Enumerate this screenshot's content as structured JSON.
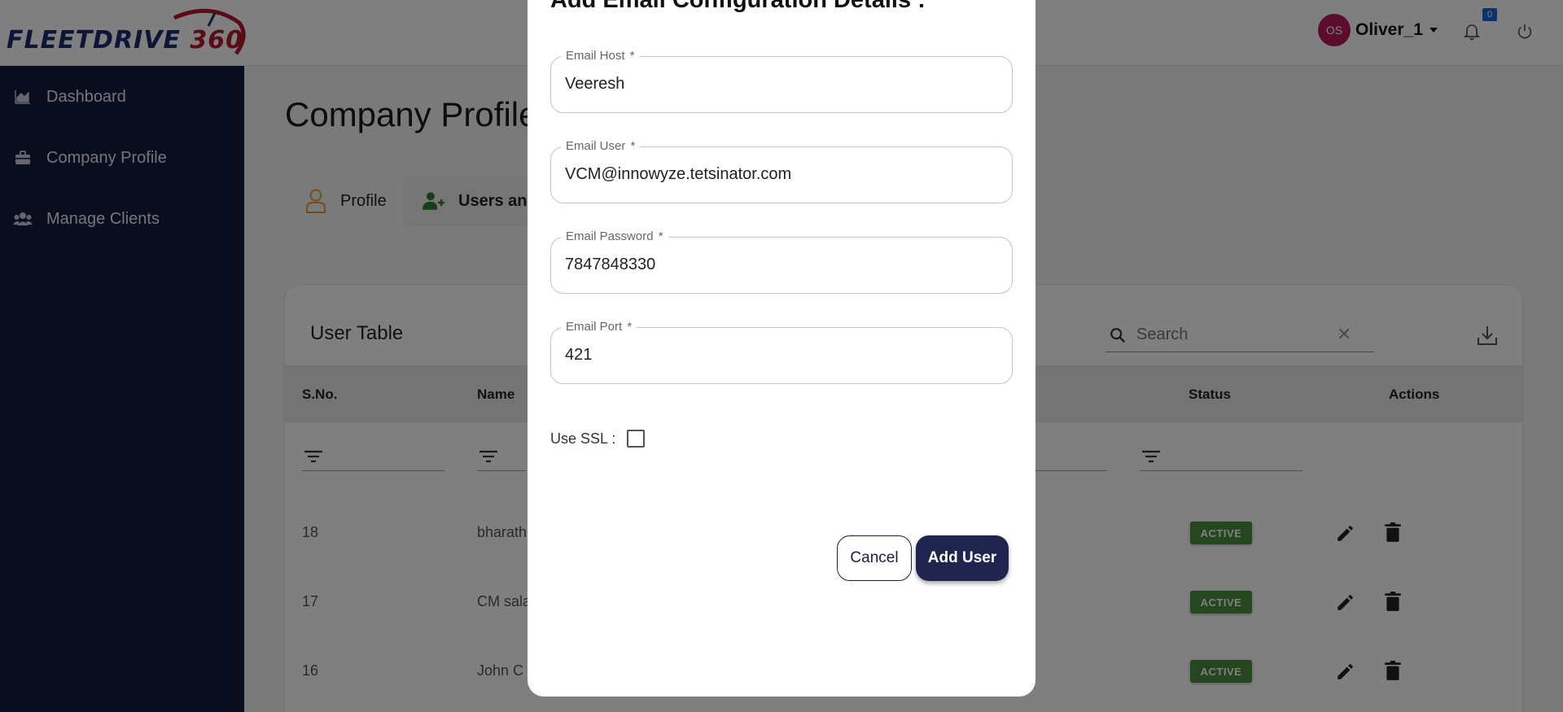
{
  "brand": {
    "logo_text": "FLEETDRIVE",
    "logo_number": "360",
    "primary_color": "#141a3d",
    "accent_color": "#b3182b"
  },
  "header": {
    "user_initials": "OS",
    "user_name": "Oliver_1",
    "notification_count": "0"
  },
  "sidebar": {
    "items": [
      {
        "label": "Dashboard",
        "icon": "chart-area-icon"
      },
      {
        "label": "Company Profile",
        "icon": "briefcase-icon"
      },
      {
        "label": "Manage Clients",
        "icon": "users-icon"
      }
    ]
  },
  "page": {
    "title": "Company Profile",
    "tabs": [
      {
        "label": "Profile",
        "icon": "user-outline-icon"
      },
      {
        "label": "Users and",
        "icon": "user-plus-icon"
      }
    ]
  },
  "table": {
    "title": "User Table",
    "search_placeholder": "Search",
    "columns": [
      "S.No.",
      "Name",
      "Status",
      "Actions"
    ],
    "rows": [
      {
        "sno": "18",
        "name": "bharath",
        "status": "ACTIVE"
      },
      {
        "sno": "17",
        "name": "CM sala",
        "status": "ACTIVE"
      },
      {
        "sno": "16",
        "name": "John C",
        "status": "ACTIVE"
      }
    ]
  },
  "modal": {
    "title": "Add Email Configuration Details :",
    "fields": [
      {
        "label": "Email Host",
        "value": "Veeresh"
      },
      {
        "label": "Email User",
        "value": "VCM@innowyze.tetsinator.com"
      },
      {
        "label": "Email Password",
        "value": "7847848330"
      },
      {
        "label": "Email Port",
        "value": "421"
      }
    ],
    "required_marker": "*",
    "ssl_label": "Use SSL :",
    "ssl_checked": false,
    "cancel_label": "Cancel",
    "submit_label": "Add User"
  }
}
